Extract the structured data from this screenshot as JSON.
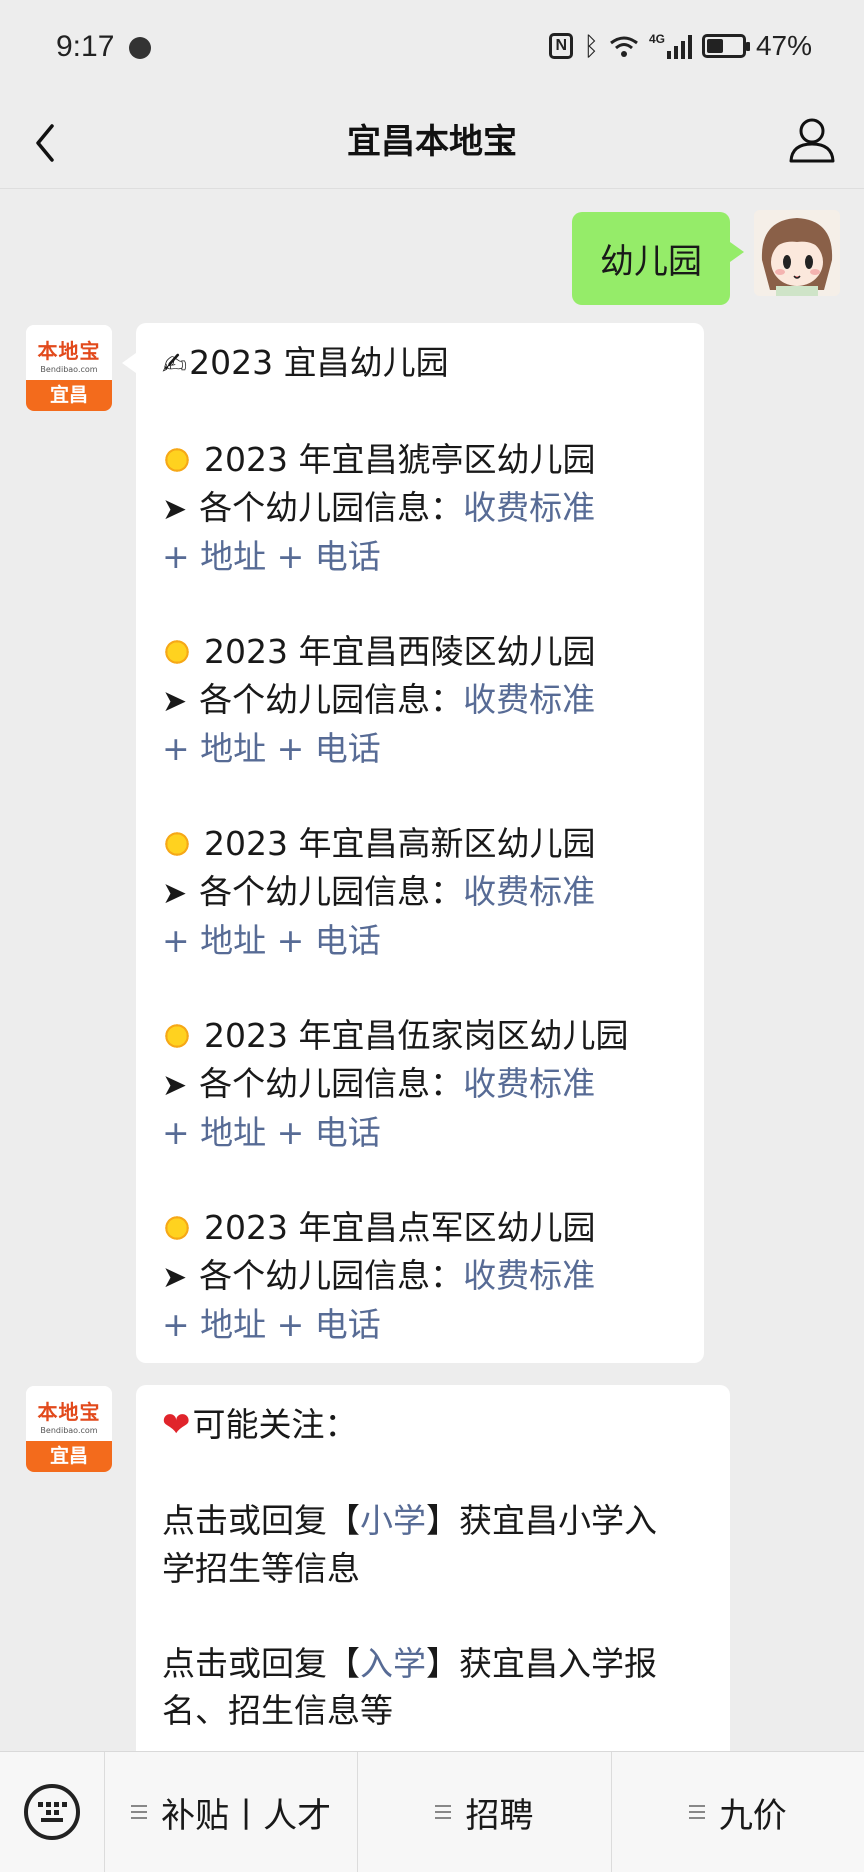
{
  "status": {
    "time": "9:17",
    "network": "4G",
    "battery": "47%",
    "battery_level": 0.47
  },
  "nav": {
    "title": "宜昌本地宝"
  },
  "outgoing": {
    "text": "幼儿园"
  },
  "bot": {
    "avatar_brand": "本地宝",
    "avatar_domain": "Bendibao.com",
    "avatar_city": "宜昌"
  },
  "message1": {
    "title": "2023 宜昌幼儿园",
    "districts": [
      {
        "heading": "2023 年宜昌猇亭区幼儿园",
        "info": "各个幼儿园信息：",
        "link1": "收费标准",
        "link2": "+ 地址 + 电话"
      },
      {
        "heading": "2023 年宜昌西陵区幼儿园",
        "info": "各个幼儿园信息：",
        "link1": "收费标准",
        "link2": "+ 地址 + 电话"
      },
      {
        "heading": "2023 年宜昌高新区幼儿园",
        "info": "各个幼儿园信息：",
        "link1": "收费标准",
        "link2": "+ 地址 + 电话"
      },
      {
        "heading": "2023 年宜昌伍家岗区幼儿园",
        "info": "各个幼儿园信息：",
        "link1": "收费标准",
        "link2": "+ 地址 + 电话"
      },
      {
        "heading": "2023 年宜昌点军区幼儿园",
        "info": "各个幼儿园信息：",
        "link1": "收费标准",
        "link2": "+ 地址 + 电话"
      }
    ]
  },
  "message2": {
    "title": "可能关注：",
    "items": [
      {
        "prefix": "点击或回复【",
        "link": "小学",
        "suffix": "】获宜昌小学入",
        "line2": "学招生等信息"
      },
      {
        "prefix": "点击或回复【",
        "link": "入学",
        "suffix": "】获宜昌入学报",
        "line2": "名、招生信息等"
      }
    ]
  },
  "menu": {
    "items": [
      "补贴丨人才",
      "招聘",
      "九价"
    ]
  }
}
